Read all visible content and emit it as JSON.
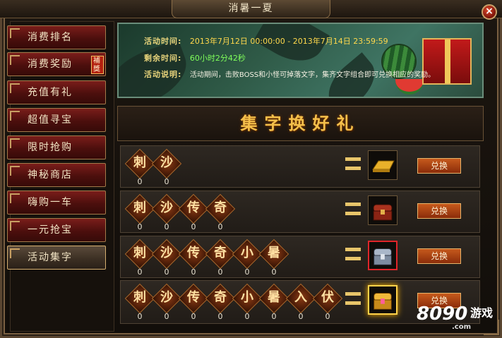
{
  "window": {
    "title": "消暑一夏",
    "close_label": "×"
  },
  "sidebar": {
    "items": [
      {
        "label": "消费排名"
      },
      {
        "label": "消费奖励",
        "badge": "補獎"
      },
      {
        "label": "充值有礼"
      },
      {
        "label": "超值寻宝"
      },
      {
        "label": "限时抢购"
      },
      {
        "label": "神秘商店"
      },
      {
        "label": "嗨购一车"
      },
      {
        "label": "一元抢宝"
      },
      {
        "label": "活动集字",
        "active": true
      }
    ]
  },
  "banner": {
    "time_label": "活动时间:",
    "time_value": "2013年7月12日 00:00:00 - 2013年7月14日 23:59:59",
    "remain_label": "剩余时间:",
    "remain_value": "60小时2分42秒",
    "desc_label": "活动说明:",
    "desc_value": "活动期间，击败BOSS和小怪可掉落文字，集齐文字组合即可兑换相应的奖励。"
  },
  "header": {
    "title": "集字换好礼"
  },
  "rows": [
    {
      "chars": [
        "刺",
        "沙"
      ],
      "counts": [
        "0",
        "0"
      ],
      "prize_icon": "gold-bar-icon",
      "button": "兑换"
    },
    {
      "chars": [
        "刺",
        "沙",
        "传",
        "奇"
      ],
      "counts": [
        "0",
        "0",
        "0",
        "0"
      ],
      "prize_icon": "red-chest-icon",
      "button": "兑换"
    },
    {
      "chars": [
        "刺",
        "沙",
        "传",
        "奇",
        "小",
        "暑"
      ],
      "counts": [
        "0",
        "0",
        "0",
        "0",
        "0",
        "0"
      ],
      "prize_icon": "silver-chest-icon",
      "button": "兑换"
    },
    {
      "chars": [
        "刺",
        "沙",
        "传",
        "奇",
        "小",
        "暑",
        "入",
        "伏"
      ],
      "counts": [
        "0",
        "0",
        "0",
        "0",
        "0",
        "0",
        "0",
        "0"
      ],
      "prize_icon": "gold-chest-icon",
      "button": "兑换"
    }
  ],
  "watermark": {
    "number": "8090",
    "text": "游戏",
    "domain": ".com"
  },
  "colors": {
    "accent_gold": "#f5c04b",
    "sidebar_red": "#7a1d1a",
    "button_orange": "#c65a1c"
  }
}
